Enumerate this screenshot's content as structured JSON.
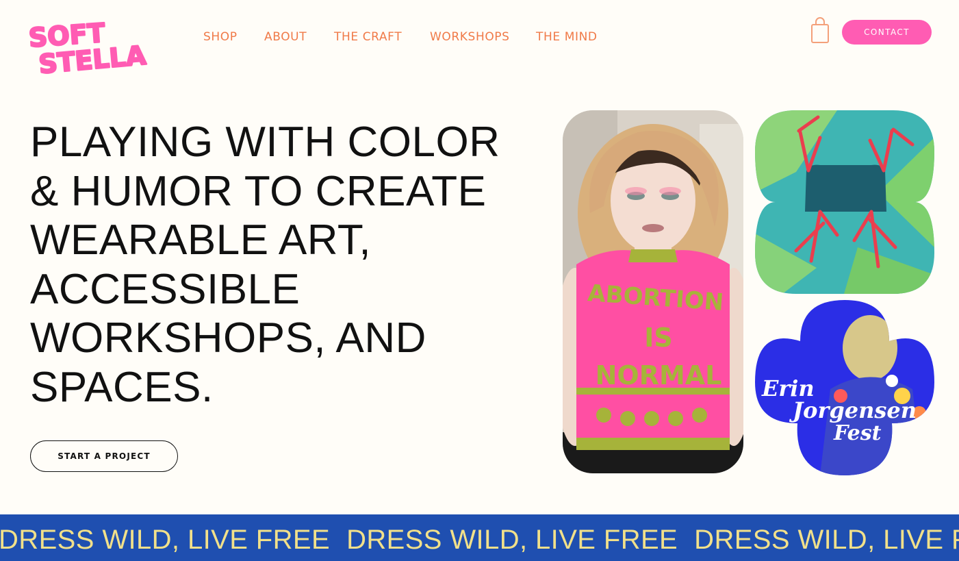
{
  "logo": {
    "line1": "SOFT",
    "line2": "STELLA",
    "color": "#ff5cb3"
  },
  "nav": {
    "items": [
      {
        "label": "SHOP"
      },
      {
        "label": "ABOUT"
      },
      {
        "label": "THE CRAFT"
      },
      {
        "label": "WORKSHOPS"
      },
      {
        "label": "THE MIND"
      }
    ],
    "color": "#f07a48"
  },
  "header": {
    "cart_icon": "shopping-bag-icon",
    "contact_label": "CONTACT",
    "contact_color": "#ff5cb3"
  },
  "hero": {
    "headline": "PLAYING WITH COLOR & HUMOR TO CREATE WEARABLE ART, ACCESSIBLE WORKSHOPS, AND SPACES.",
    "cta_label": "START A PROJECT"
  },
  "gallery": {
    "portrait_sweater_text": [
      "ABORTION",
      "IS",
      "NORMAL"
    ],
    "poster_text": [
      "Erin",
      "Jorgensen",
      "Fest"
    ]
  },
  "banner": {
    "text": "DRESS WILD, LIVE FREE",
    "background": "#1f4fb0",
    "text_color": "#f1e08a"
  }
}
